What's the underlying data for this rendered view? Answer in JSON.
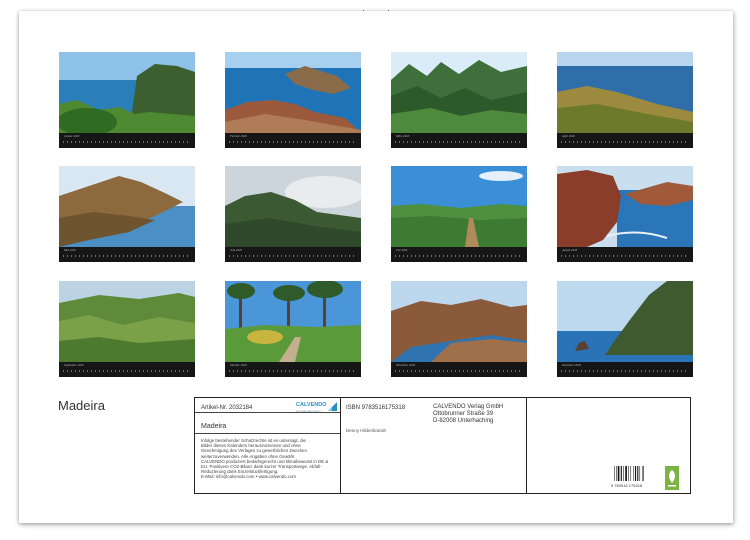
{
  "calendar": {
    "title": "Madeira",
    "months": [
      {
        "label": "Januar 2026",
        "scene": "coast-cliff-green"
      },
      {
        "label": "Februar 2026",
        "scene": "peninsula-ocean"
      },
      {
        "label": "März 2026",
        "scene": "green-mountains"
      },
      {
        "label": "April 2026",
        "scene": "grass-ocean"
      },
      {
        "label": "Mai 2026",
        "scene": "brown-headland"
      },
      {
        "label": "Juni 2026",
        "scene": "misty-mountain"
      },
      {
        "label": "Juli 2026",
        "scene": "green-trail"
      },
      {
        "label": "August 2026",
        "scene": "red-cliffs-sea"
      },
      {
        "label": "September 2026",
        "scene": "terraced-hills"
      },
      {
        "label": "Oktober 2026",
        "scene": "forest-path"
      },
      {
        "label": "November 2026",
        "scene": "brown-ridge-sea"
      },
      {
        "label": "Dezember 2026",
        "scene": "cliff-sea-rock"
      }
    ]
  },
  "info": {
    "article_number": "Artikel-Nr. 2032184",
    "calendar_name": "Madeira",
    "legal_lines": [
      "Infolge bestehender Schutzrechte ist es untersagt, die",
      "Bilder dieses Kalenders herauszutrennen und ohne",
      "Genehmigung des Verlages zu gewerblichen Zwecken",
      "weiterzuverwenden. Alle Angaben ohne Gewähr.",
      "CALVENDO produziert bedarfsgerecht und klimabewusst in DE &",
      "EU. Positivere CO2-Bilanz dank kurzer Transportwege. Abfall-",
      "Reduzierung dank Einzelstückfertigung.",
      "E-Mail: info@calvendo.com • www.calvendo.com"
    ],
    "logo_text": "CALVENDO",
    "logo_subtext": "Ihr Kalenderverlag",
    "isbn": "ISBN 9783516175318",
    "author": "Denny Hildenbrandt",
    "publisher_lines": [
      "CALVENDO Verlag GmbH",
      "Ottobrunner Straße 39",
      "D-82008 Unterhaching"
    ],
    "barcode_number": "9 783516 175318",
    "colors": {
      "logo_blue": "#2a8fbf",
      "eco_green": "#7cb342"
    }
  }
}
